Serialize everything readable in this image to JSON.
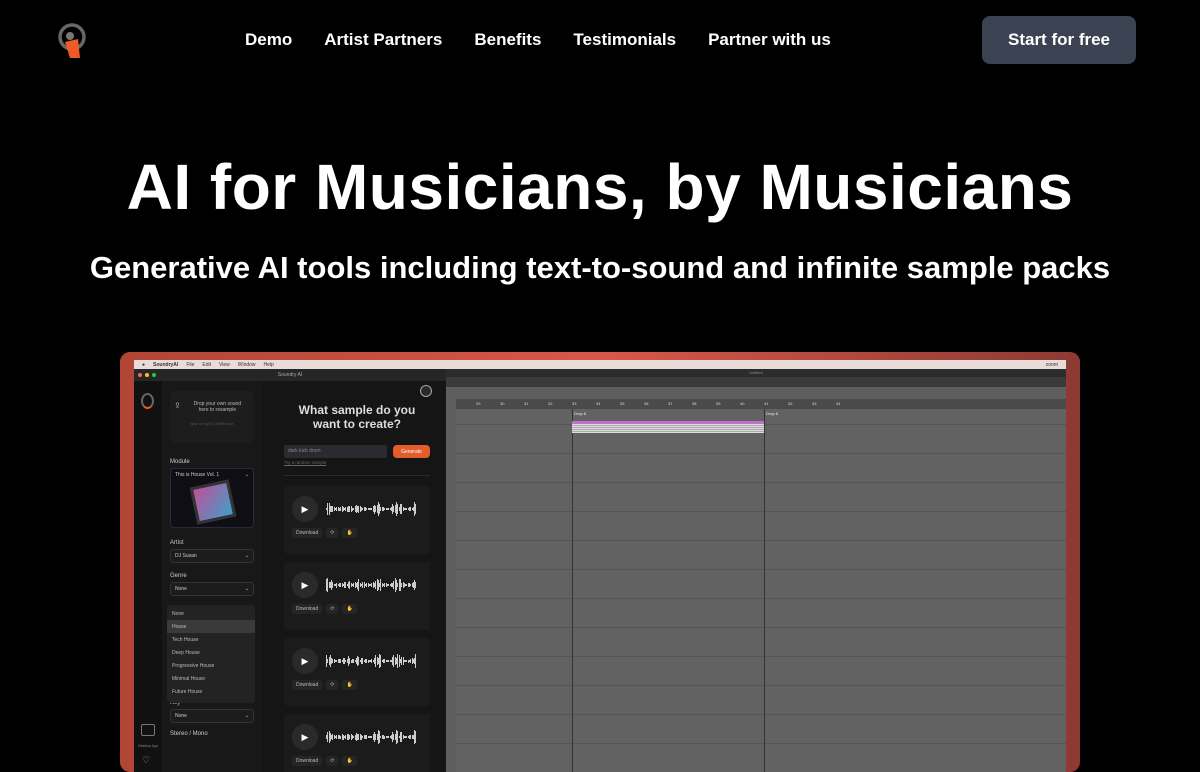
{
  "brand": {
    "logo_icon": "headphone-logo-icon",
    "accent": "#e35d2b"
  },
  "nav": {
    "items": [
      "Demo",
      "Artist Partners",
      "Benefits",
      "Testimonials",
      "Partner with us"
    ],
    "cta": "Start for free"
  },
  "hero": {
    "title": "AI for Musicians, by Musicians",
    "subtitle": "Generative AI tools including text-to-sound and infinite sample packs"
  },
  "demo": {
    "menubar": {
      "app": "SoundryAI",
      "items": [
        "File",
        "Edit",
        "View",
        "Window",
        "Help"
      ],
      "right": "zoom"
    },
    "window_title": "Soundry AI",
    "drop": {
      "line1": "Drop your own sound",
      "line2": "here to resample",
      "hint": "wav or mp3 | 20MB max"
    },
    "module": {
      "label": "Module",
      "value": "This is House Vol. 1"
    },
    "artist": {
      "label": "Artist",
      "value": "DJ Susan"
    },
    "genre": {
      "label": "Genre",
      "value": "None",
      "options": [
        "None",
        "House",
        "Tech House",
        "Deep House",
        "Progressive House",
        "Minimal House",
        "Future House"
      ],
      "highlighted": "House"
    },
    "key": {
      "label": "Key",
      "value": "None"
    },
    "stereo": {
      "label": "Stereo / Mono"
    },
    "rail": {
      "desktop": "Desktop App",
      "community": "Community"
    },
    "main": {
      "question": "What sample do you want to create?",
      "placeholder": "dark kick drum",
      "generate": "Generate",
      "random": "Try a random sample",
      "download": "Download"
    },
    "daw": {
      "title": "Untitled",
      "ruler": [
        "29",
        "30",
        "31",
        "32",
        "33",
        "34",
        "35",
        "36",
        "37",
        "38",
        "39",
        "40",
        "41",
        "42",
        "43",
        "44"
      ],
      "clips": [
        "Drop 8",
        "Drop 8"
      ]
    }
  }
}
